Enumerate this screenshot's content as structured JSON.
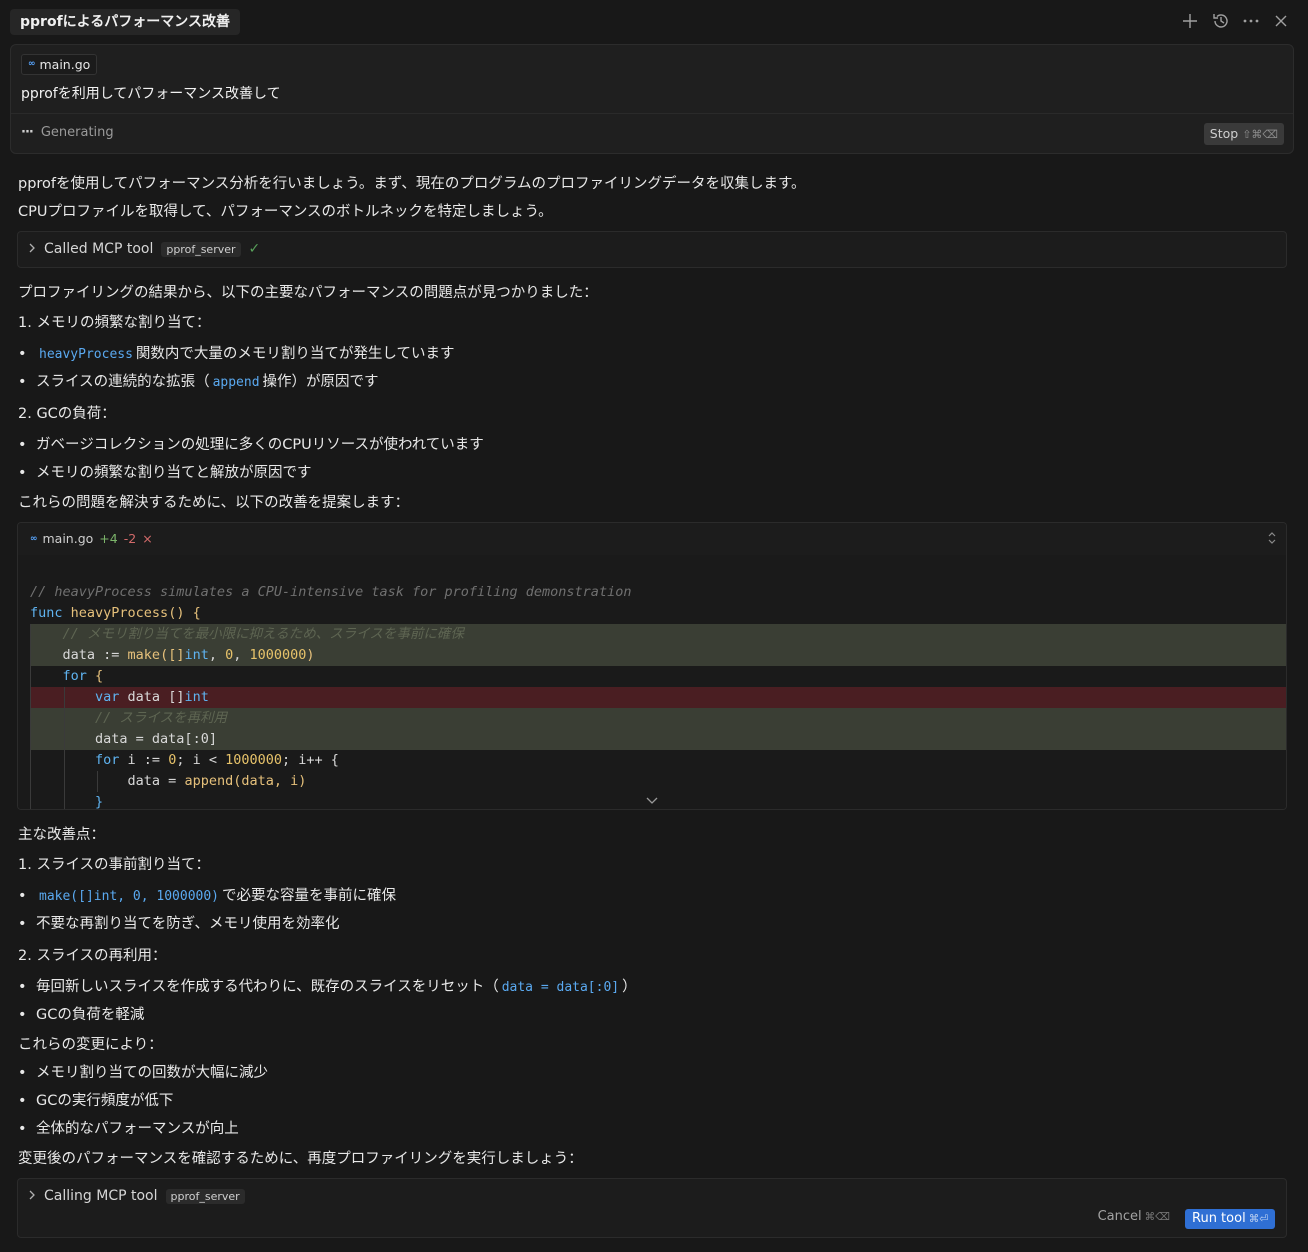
{
  "header": {
    "title": "pprofによるパフォーマンス改善"
  },
  "input": {
    "file_chip": "main.go",
    "prompt": "pprofを利用してパフォーマンス改善して",
    "status": "Generating",
    "stop_label": "Stop",
    "stop_shortcut": "⇧⌘⌫"
  },
  "messages": {
    "intro1": "pprofを使用してパフォーマンス分析を行いましょう。まず、現在のプログラムのプロファイリングデータを収集します。",
    "intro2": "CPUプロファイルを取得して、パフォーマンスのボトルネックを特定しましょう。",
    "tool1": {
      "label": "Called MCP tool",
      "tag": "pprof_server",
      "status": "✓"
    },
    "results_intro": "プロファイリングの結果から、以下の主要なパフォーマンスの問題点が見つかりました：",
    "issue1_title": "1. メモリの頻繁な割り当て：",
    "issue1_b1_code": "heavyProcess",
    "issue1_b1_text": "関数内で大量のメモリ割り当てが発生しています",
    "issue1_b2_pre": "スライスの連続的な拡張（",
    "issue1_b2_code": "append",
    "issue1_b2_post": "操作）が原因です",
    "issue2_title": "2. GCの負荷：",
    "issue2_b1": "ガベージコレクションの処理に多くのCPUリソースが使われています",
    "issue2_b2": "メモリの頻繁な割り当てと解放が原因です",
    "proposal_intro": "これらの問題を解決するために、以下の改善を提案します：",
    "improve_title": "主な改善点：",
    "imp1_title": "1. スライスの事前割り当て：",
    "imp1_b1_code": "make([]int, 0, 1000000)",
    "imp1_b1_text": "で必要な容量を事前に確保",
    "imp1_b2": "不要な再割り当てを防ぎ、メモリ使用を効率化",
    "imp2_title": "2. スライスの再利用：",
    "imp2_b1_text": "毎回新しいスライスを作成する代わりに、既存のスライスをリセット（",
    "imp2_b1_code": "data = data[:0]",
    "imp2_b1_close": "）",
    "imp2_b2": "GCの負荷を軽減",
    "effects_intro": "これらの変更により：",
    "eff1": "メモリ割り当ての回数が大幅に減少",
    "eff2": "GCの実行頻度が低下",
    "eff3": "全体的なパフォーマンスが向上",
    "rerun_intro": "変更後のパフォーマンスを確認するために、再度プロファイリングを実行しましょう：",
    "tool2": {
      "label": "Calling MCP tool",
      "tag": "pprof_server",
      "cancel": "Cancel",
      "cancel_shortcut": "⌘⌫",
      "run": "Run tool",
      "run_shortcut": "⌘⏎"
    }
  },
  "code": {
    "file": "main.go",
    "added": "+4",
    "removed": "-2",
    "remove_icon": "×",
    "lines": {
      "l1": "// heavyProcess simulates a CPU-intensive task for profiling demonstration",
      "l2_kw": "func",
      "l2_fn": "heavyProcess",
      "l2_rest": "() {",
      "l3": "// メモリ割り当てを最小限に抑えるため、スライスを事前に確保",
      "l4_a": "data := ",
      "l4_fn": "make",
      "l4_b": "([]",
      "l4_kw": "int",
      "l4_c": ", ",
      "l4_n1": "0",
      "l4_d": ", ",
      "l4_n2": "1000000",
      "l4_e": ")",
      "l5_kw": "for",
      "l5_rest": " {",
      "l6_kw": "var",
      "l6_rest": " data []",
      "l6_kw2": "int",
      "l7": "// スライスを再利用",
      "l8": "data = data[:0]",
      "l9_kw": "for",
      "l9_a": " i := ",
      "l9_n1": "0",
      "l9_b": "; i < ",
      "l9_n2": "1000000",
      "l9_c": "; i++ {",
      "l10_a": "data = ",
      "l10_fn": "append",
      "l10_b": "(data, i)",
      "l11": "}"
    }
  },
  "colors": {
    "background": "#181818",
    "accent": "#2f6fd4",
    "added_line": "#3a3e34",
    "removed_line": "#4a1e22",
    "inline_code": "#5aa9f0"
  }
}
